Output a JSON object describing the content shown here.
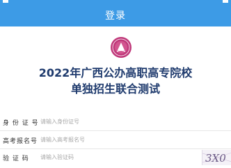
{
  "header": {
    "title": "登录"
  },
  "page": {
    "title_line1": "2022年广西公办高职高专院校",
    "title_line2": "单独招生联合测试"
  },
  "form": {
    "id_label": "身 份 证 号",
    "id_placeholder": "请输入身份证号",
    "exam_label": "高考报名号",
    "exam_placeholder": "请输入高考报名号",
    "captcha_label": "验   证   码",
    "captcha_placeholder": "请输入验证码",
    "captcha_text": "3X0"
  },
  "colors": {
    "accent": "#3d9be6",
    "title": "#1e3a6d",
    "logo": "#c0397a"
  }
}
